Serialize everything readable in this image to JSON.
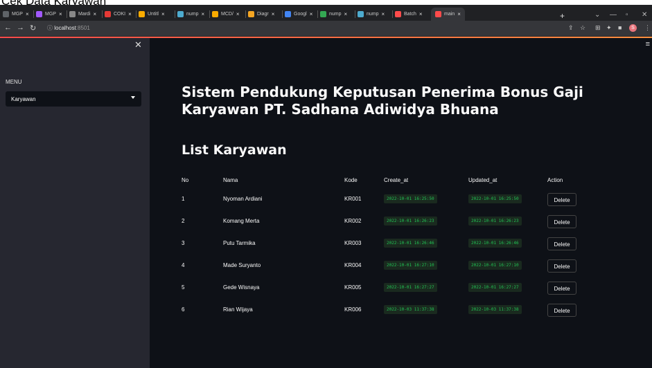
{
  "caption": "Cek Data Karyawan",
  "browser": {
    "tabs": [
      {
        "label": "MGP",
        "favicon": "doc-icon",
        "color": "#5f6368"
      },
      {
        "label": "MGP",
        "favicon": "figma-icon",
        "color": "#a259ff"
      },
      {
        "label": "Mardi",
        "favicon": "globe-icon",
        "color": "#888888"
      },
      {
        "label": "COKI",
        "favicon": "youtube-icon",
        "color": "#e53935"
      },
      {
        "label": "Untitl",
        "favicon": "colab-icon",
        "color": "#f9ab00"
      },
      {
        "label": "nump",
        "favicon": "numpy-icon",
        "color": "#4dabcf"
      },
      {
        "label": "MCD/",
        "favicon": "colab-icon",
        "color": "#f9ab00"
      },
      {
        "label": "Diagr",
        "favicon": "diagram-icon",
        "color": "#f5a623"
      },
      {
        "label": "Googl",
        "favicon": "google-icon",
        "color": "#4285f4"
      },
      {
        "label": "nump",
        "favicon": "chrome-icon",
        "color": "#34a853"
      },
      {
        "label": "nump",
        "favicon": "numpy-icon",
        "color": "#4dabcf"
      },
      {
        "label": "Batch",
        "favicon": "streamlit-icon",
        "color": "#ff4b4b"
      },
      {
        "label": "main",
        "favicon": "streamlit-icon",
        "color": "#ff4b4b"
      }
    ],
    "url_host": "localhost",
    "url_port": ":8501"
  },
  "sidebar": {
    "menu_label": "MENU",
    "menu_selected": "Karyawan"
  },
  "main": {
    "title": "Sistem Pendukung Keputusan Penerima Bonus Gaji Karyawan PT. Sadhana Adiwidya Bhuana",
    "subheader": "List Karyawan",
    "columns": [
      "No",
      "Nama",
      "Kode",
      "Create_at",
      "Updated_at",
      "Action"
    ],
    "rows": [
      {
        "no": "1",
        "nama": "Nyoman Ardiani",
        "kode": "KR001",
        "create_at": "2022-10-01 16:25:50",
        "updated_at": "2022-10-01 16:25:50",
        "action": "Delete"
      },
      {
        "no": "2",
        "nama": "Komang Merta",
        "kode": "KR002",
        "create_at": "2022-10-01 16:26:23",
        "updated_at": "2022-10-01 16:26:23",
        "action": "Delete"
      },
      {
        "no": "3",
        "nama": "Putu Tarmika",
        "kode": "KR003",
        "create_at": "2022-10-01 16:26:46",
        "updated_at": "2022-10-01 16:26:46",
        "action": "Delete"
      },
      {
        "no": "4",
        "nama": "Made Suryanto",
        "kode": "KR004",
        "create_at": "2022-10-01 16:27:10",
        "updated_at": "2022-10-01 16:27:10",
        "action": "Delete"
      },
      {
        "no": "5",
        "nama": "Gede Wisnaya",
        "kode": "KR005",
        "create_at": "2022-10-01 16:27:27",
        "updated_at": "2022-10-01 16:27:27",
        "action": "Delete"
      },
      {
        "no": "6",
        "nama": "Rian Wijaya",
        "kode": "KR006",
        "create_at": "2022-10-03 11:37:38",
        "updated_at": "2022-10-03 11:37:38",
        "action": "Delete"
      }
    ]
  },
  "colors": {
    "sidebar_bg": "#262730",
    "main_bg": "#0e1117",
    "accent": "#ff4b4b",
    "timestamp_green": "#21c354"
  }
}
